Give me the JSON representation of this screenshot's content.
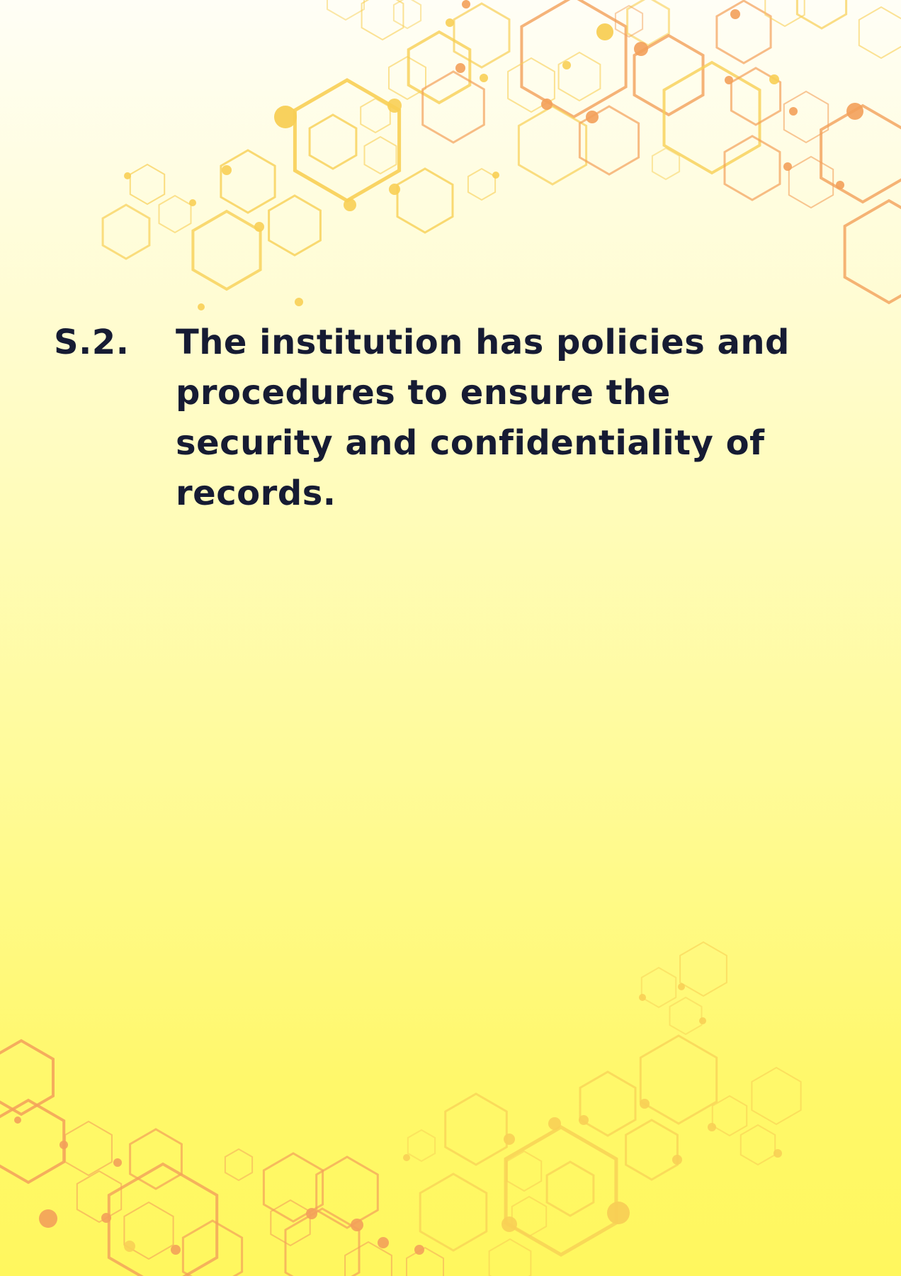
{
  "section": {
    "number": "S.2.",
    "text": "The institution has policies and procedures to ensure the security and confidentiality of records."
  },
  "colors": {
    "text": "#161b33",
    "hex_yellow": "#f8cf55",
    "hex_orange": "#f3a05a",
    "background_top": "#fffef6",
    "background_bottom": "#fff75e"
  },
  "decoration": {
    "top_pattern": "hexagon-network-icon",
    "bottom_pattern": "hexagon-network-icon"
  }
}
